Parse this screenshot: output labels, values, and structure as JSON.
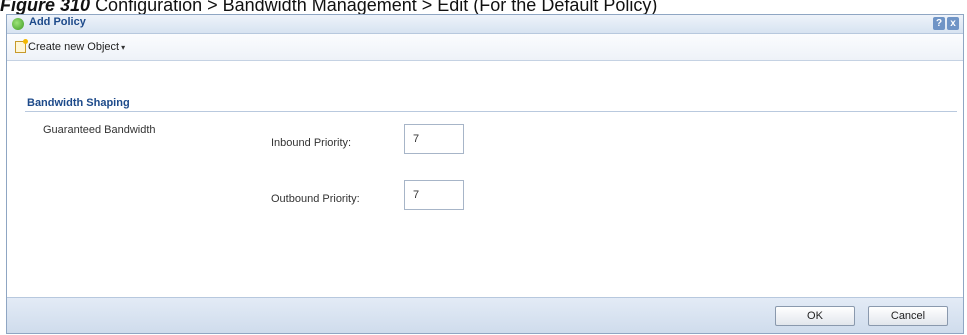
{
  "caption": {
    "figure_label": "Figure 310",
    "text": "Configuration > Bandwidth Management > Edit (For the Default Policy)"
  },
  "dialog": {
    "title": "Add Policy",
    "title_icon": "green-circle-icon",
    "title_buttons": [
      "?",
      "x"
    ]
  },
  "toolbar": {
    "create_label": "Create new Object",
    "create_icon": "new-object-icon"
  },
  "section": {
    "title": "Bandwidth Shaping"
  },
  "fields": {
    "guaranteed_bandwidth_label": "Guaranteed Bandwidth",
    "inbound_priority_label": "Inbound Priority:",
    "inbound_priority_value": "7",
    "outbound_priority_label": "Outbound Priority:",
    "outbound_priority_value": "7"
  },
  "footer": {
    "ok_label": "OK",
    "cancel_label": "Cancel"
  },
  "colors": {
    "title_text": "#1d4a8a",
    "border": "#8fa6c3",
    "footer_bg": "#d9e4f1"
  }
}
